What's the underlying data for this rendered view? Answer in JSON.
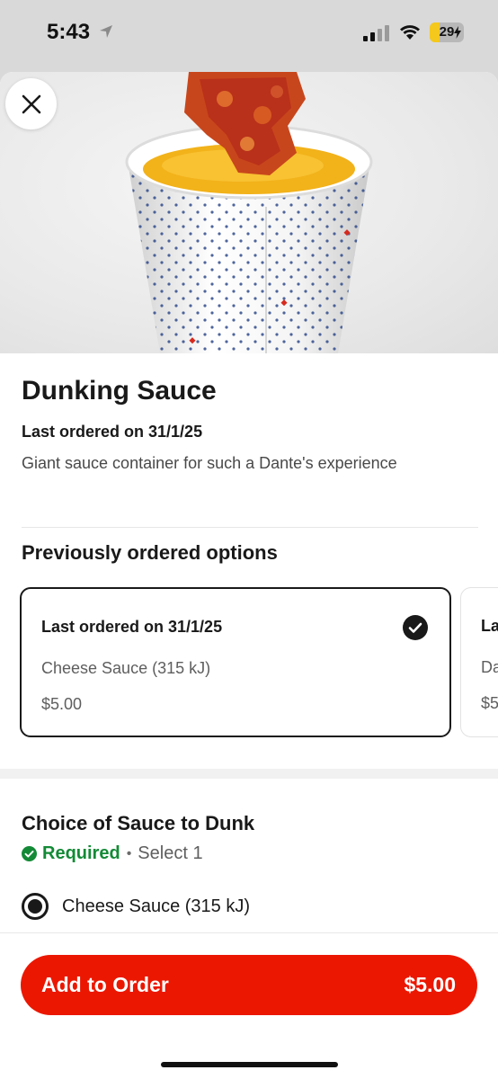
{
  "status_bar": {
    "time": "5:43",
    "battery_level": "29",
    "colors": {
      "battery": "#f4c81c"
    }
  },
  "product": {
    "name": "Dunking Sauce",
    "last_ordered": "Last ordered on 31/1/25",
    "description": "Giant sauce container for such a Dante's experience"
  },
  "previous_options": {
    "title": "Previously ordered options",
    "cards": [
      {
        "heading": "Last ordered on 31/1/25",
        "description": "Cheese Sauce (315 kJ)",
        "price": "$5.00",
        "selected": true
      },
      {
        "heading": "La",
        "description": "Da",
        "price": "$5"
      }
    ]
  },
  "sauce_choice": {
    "title": "Choice of Sauce to Dunk",
    "required_label": "Required",
    "select_label": "Select 1",
    "options": [
      {
        "label": "Cheese Sauce (315 kJ)",
        "selected": true
      }
    ]
  },
  "footer": {
    "button_label": "Add to Order",
    "price": "$5.00",
    "colors": {
      "button": "#eb1700"
    }
  },
  "colors": {
    "required": "#138a36"
  }
}
